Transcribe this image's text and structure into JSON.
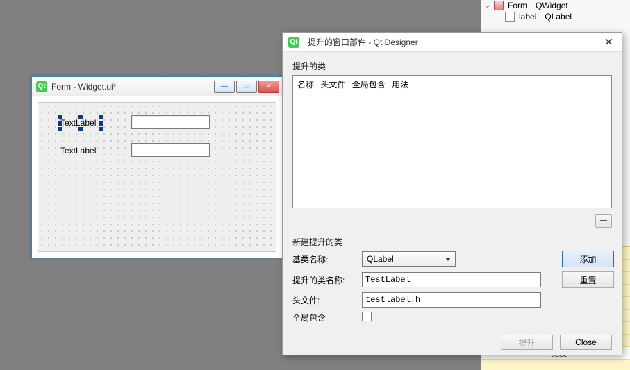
{
  "form_window": {
    "title": "Form - Widget.ui*",
    "label1_text": "TextLabel",
    "label2_text": "TextLabel"
  },
  "dialog": {
    "title": "提升的窗口部件 - Qt Designer",
    "promoted_section": "提升的类",
    "columns": {
      "name": "名称",
      "header": "头文件",
      "global": "全局包含",
      "usage": "用法"
    },
    "new_section": "新建提升的类",
    "base_label": "基类名称:",
    "base_value": "QLabel",
    "promoted_name_label": "提升的类名称:",
    "promoted_name_value": "TestLabel",
    "header_label": "头文件:",
    "header_value": "testlabel.h",
    "global_include_label": "全局包含",
    "add_btn": "添加",
    "reset_btn": "重置",
    "promote_btn": "提升",
    "close_btn": "Close"
  },
  "inspector": {
    "root_name": "Form",
    "root_class": "QWidget",
    "child_name": "label",
    "child_class": "QLabel",
    "prop_width": "宽度"
  }
}
